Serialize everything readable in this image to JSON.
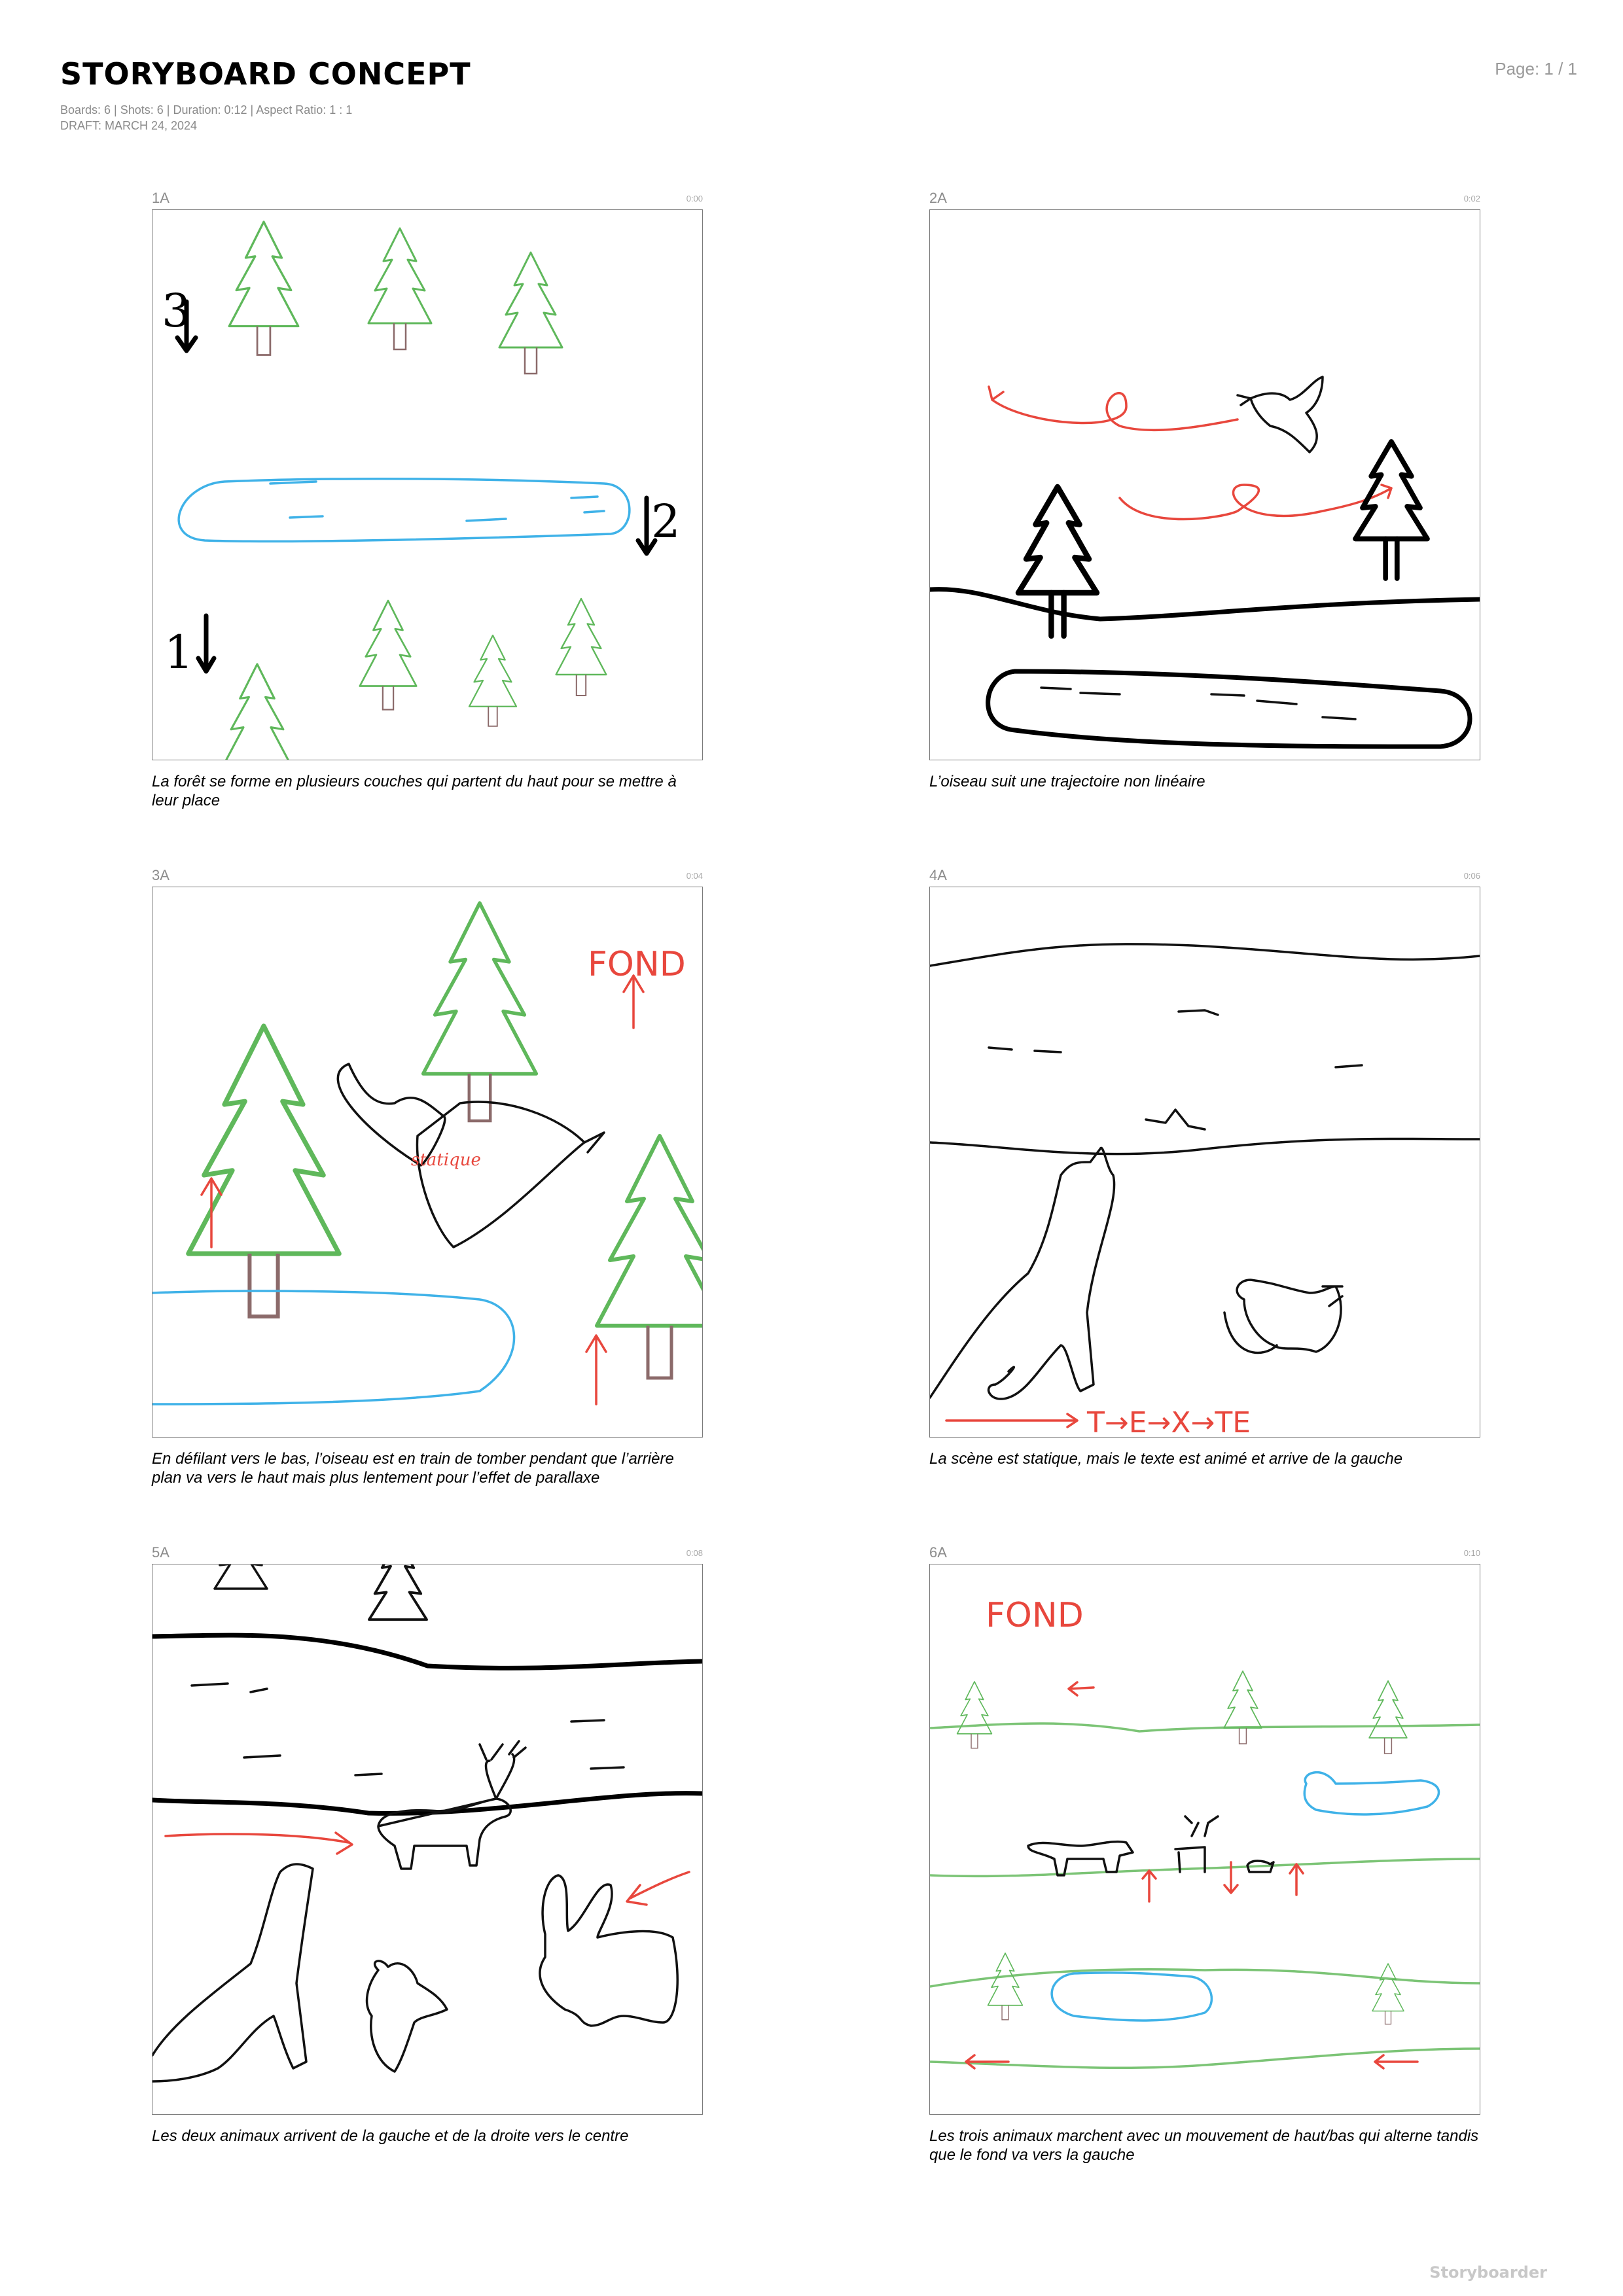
{
  "document": {
    "title": "STORYBOARD CONCEPT",
    "meta_line": "Boards: 6  |  Shots: 6  |  Duration: 0:12  |  Aspect Ratio: 1 : 1",
    "draft": "DRAFT: MARCH 24, 2024",
    "page": "Page: 1 / 1",
    "brand": "Storyboarder"
  },
  "boards": [
    {
      "label": "1A",
      "time": "0:00",
      "caption": "La forêt se forme en plusieurs couches qui partent du haut pour se mettre à leur place",
      "marks": [
        "3",
        "2",
        "1"
      ]
    },
    {
      "label": "2A",
      "time": "0:02",
      "caption": "L’oiseau suit une trajectoire non linéaire"
    },
    {
      "label": "3A",
      "time": "0:04",
      "caption": "En défilant vers le bas, l’oiseau est en train de tomber pendant que l’arrière plan va vers le haut mais plus lentement pour l’effet de parallaxe",
      "marks": [
        "FOND",
        "statique"
      ]
    },
    {
      "label": "4A",
      "time": "0:06",
      "caption": "La scène est statique, mais le texte est animé et arrive de la gauche",
      "marks": [
        "T→E→X→TE"
      ]
    },
    {
      "label": "5A",
      "time": "0:08",
      "caption": "Les deux animaux arrivent de la gauche et de la droite vers le centre"
    },
    {
      "label": "6A",
      "time": "0:10",
      "caption": "Les trois animaux marchent avec un mouvement de haut/bas qui alterne tandis que le fond va vers la gauche",
      "marks": [
        "FOND"
      ]
    }
  ],
  "colors": {
    "trees": "#5fb85b",
    "water": "#3fb2e8",
    "motion": "#e8473d",
    "ink": "#111111"
  }
}
